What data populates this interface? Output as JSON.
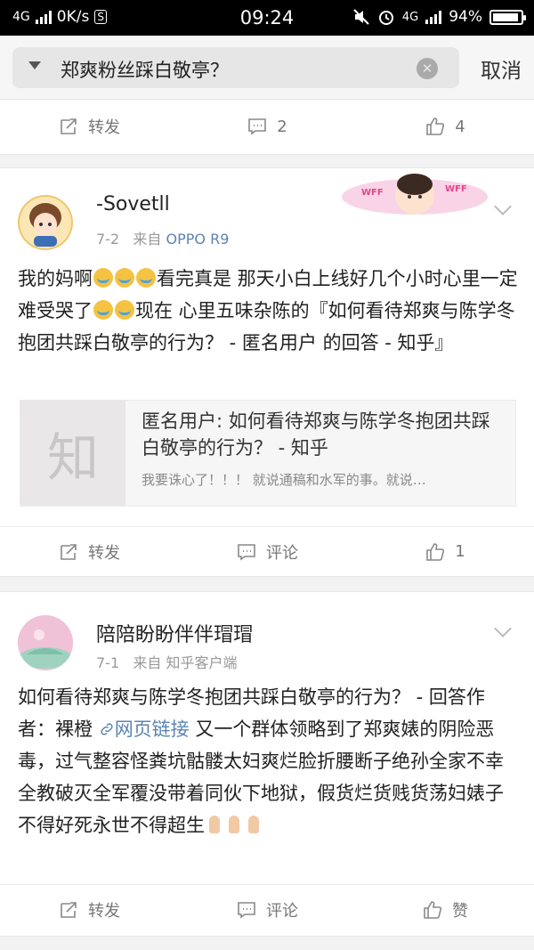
{
  "status_bar": {
    "network": "4G",
    "speed": "0K/s",
    "s_icon": "S",
    "time": "09:24",
    "network_right": "4G",
    "battery": "94%",
    "battery_level": 0.94
  },
  "search": {
    "query": "郑爽粉丝踩白敬亭？",
    "cancel_label": "取消"
  },
  "prev_post": {
    "actions": {
      "repost": "转发",
      "comment_count": "2",
      "like_count": "4"
    }
  },
  "post1": {
    "username": "-Sovetll",
    "date": "7-2",
    "from_label": "来自",
    "source": "OPPO R9",
    "text_a": "我的妈啊",
    "text_b": "看完真是 那天小白上线好几个小时心里一定难受哭了",
    "text_c": "现在 心里五味杂陈的『如何看待郑爽与陈学冬抱团共踩白敬亭的行为？ - 匿名用户 的回答 - 知乎』",
    "link_card": {
      "thumb_char": "知",
      "title": "匿名用户: 如何看待郑爽与陈学冬抱团共踩白敬亭的行为？ - 知乎",
      "desc": "我要诛心了！！！ 就说通稿和水军的事。就说…"
    },
    "badge_text": "WFF",
    "actions": {
      "repost": "转发",
      "comment": "评论",
      "like_count": "1"
    }
  },
  "post2": {
    "username": "陪陪盼盼伴伴瑁瑁",
    "date": "7-1",
    "from_label": "来自",
    "source": "知乎客户端",
    "text_a": "如何看待郑爽与陈学冬抱团共踩白敬亭的行为？ - 回答作者：裸橙 ",
    "link_text": "网页链接",
    "text_b": " 又一个群体领略到了郑爽婊的阴险恶毒，过气整容怪粪坑骷髅太妇爽烂脸折腰断子绝孙全家不幸全教破灭全军覆没带着同伙下地狱，假货烂货贱货荡妇婊子不得好死永世不得超生",
    "actions": {
      "repost": "转发",
      "comment": "评论",
      "like": "赞"
    }
  }
}
